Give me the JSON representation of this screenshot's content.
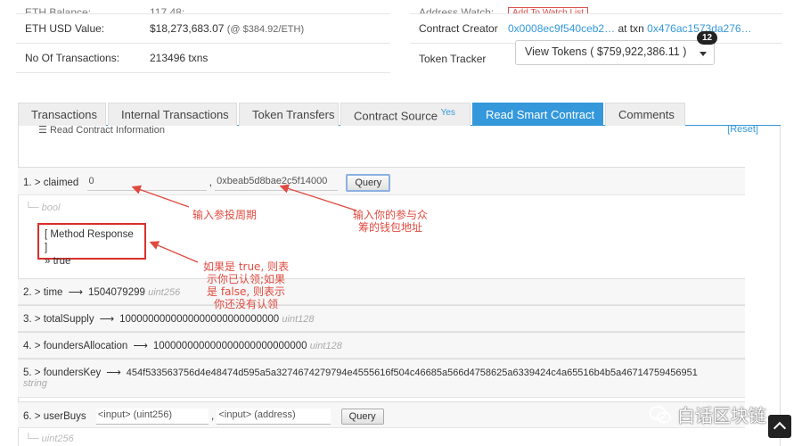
{
  "overview": {
    "top_cut": {
      "label": "ETH Balance:",
      "value": "117,48:…"
    },
    "usd_value": {
      "label": "ETH USD Value:",
      "value": "$18,273,683.07",
      "note": "(@ $384.92/ETH)"
    },
    "tx_count": {
      "label": "No Of Transactions:",
      "value": "213496 txns"
    }
  },
  "contract": {
    "top_cut": {
      "label": "Address Watch:",
      "button": "Add To Watch List"
    },
    "creator": {
      "label": "Contract Creator",
      "address": "0x0008ec9f540ceb2…",
      "at_txn_text": "at txn",
      "txn": "0x476ac1573da276…"
    },
    "token_tracker": {
      "label": "Token Tracker",
      "select_value": "View Tokens ( $759,922,386.11 )",
      "badge": "12"
    }
  },
  "tabs": [
    {
      "label": "Transactions"
    },
    {
      "label": "Internal Transactions"
    },
    {
      "label": "Token Transfers"
    },
    {
      "label": "Contract Source",
      "sup": "Yes"
    },
    {
      "label": "Read Smart Contract",
      "active": true
    },
    {
      "label": "Comments"
    }
  ],
  "panel": {
    "header": "Read Contract Information",
    "reset": "[Reset]"
  },
  "queries": {
    "claimed": {
      "label": "1. > claimed",
      "input1": "0",
      "sep": ",",
      "input2": "0xbeab5d8bae2c5f14000",
      "button": "Query",
      "ret": "└─ bool"
    },
    "method_response": {
      "title": "[ Method Response ]",
      "result": "» true"
    },
    "time": {
      "label": "2. > time",
      "value": "1504079299",
      "type": "uint256"
    },
    "totalSupply": {
      "label": "3. > totalSupply",
      "value": "1000000000000000000000000000",
      "type": "uint128"
    },
    "foundersAllocation": {
      "label": "4. > foundersAllocation",
      "value": "100000000000000000000000000",
      "type": "uint128"
    },
    "foundersKey": {
      "label": "5. > foundersKey",
      "value": "454f533563756d4e48474d595a5a3274674279794e4555616f504c46685a566d4758625a6339424c4a65516b4b5a46714759456951",
      "type": "string"
    },
    "userBuys": {
      "label": "6. > userBuys",
      "input1_placeholder": "<input> (uint256)",
      "sep": ",",
      "input2_placeholder": "<input> (address)",
      "button": "Query",
      "ret": "└─ uint256"
    }
  },
  "annotations": {
    "period": "输入参投周期",
    "wallet": "输入你的参与众\n筹的钱包地址",
    "result": "如果是 true, 则表\n示你已认领;如果\n是 false, 则表示\n你还没有认领"
  },
  "watermark": "白话区块链",
  "colors": {
    "accent": "#3498db",
    "annotation": "#e04b40",
    "highlight_box": "#d9302b"
  },
  "icons": {
    "arrow": "long-right-arrow",
    "scroll_top": "chevron-up-icon",
    "watermark": "wechat-icon"
  }
}
